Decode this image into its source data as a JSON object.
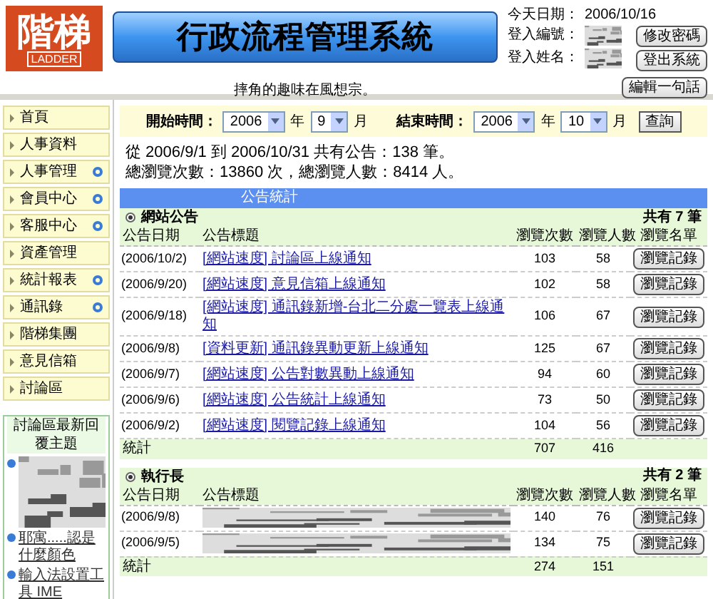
{
  "logo": {
    "text": "階梯",
    "subtext": "LADDER"
  },
  "banner": {
    "title": "行政流程管理系統"
  },
  "user_info": {
    "date_label": "今天日期：",
    "date": "2006/10/16",
    "id_label": "登入編號：",
    "name_label": "登入姓名："
  },
  "header_buttons": [
    "修改密碼",
    "登出系統"
  ],
  "motto": "摔角的趣味在風想宗。",
  "motto_button": "編輯一句話",
  "sidebar": {
    "items": [
      {
        "label": "首頁",
        "has_submenu": false
      },
      {
        "label": "人事資料",
        "has_submenu": false
      },
      {
        "label": "人事管理",
        "has_submenu": true
      },
      {
        "label": "會員中心",
        "has_submenu": true
      },
      {
        "label": "客服中心",
        "has_submenu": true
      },
      {
        "label": "資產管理",
        "has_submenu": false
      },
      {
        "label": "統計報表",
        "has_submenu": true
      },
      {
        "label": "通訊錄",
        "has_submenu": true
      },
      {
        "label": "階梯集團",
        "has_submenu": false
      },
      {
        "label": "意見信箱",
        "has_submenu": false
      },
      {
        "label": "討論區",
        "has_submenu": false
      }
    ],
    "forum_box": {
      "title": "討論區最新回覆主題",
      "items": [
        {
          "kind": "redacted"
        },
        {
          "kind": "link",
          "text": "耶寓.....認是什麼顏色"
        },
        {
          "kind": "link",
          "text": "輸入法設置工具 IME"
        }
      ]
    }
  },
  "filter": {
    "start_label": "開始時間：",
    "start_year": "2006",
    "start_year_unit": "年",
    "start_month": "9",
    "start_month_unit": "月",
    "end_label": "結束時間：",
    "end_year": "2006",
    "end_year_unit": "年",
    "end_month": "10",
    "end_month_unit": "月",
    "query_button": "查詢"
  },
  "summary": [
    "從 2006/9/1 到 2006/10/31 共有公告：138 筆。",
    "總瀏覽次數：13860 次，總瀏覽人數：8414 人。"
  ],
  "table_title": "公告統計",
  "sections": [
    {
      "name": "網站公告",
      "count": "共有 7 筆",
      "columns": [
        "公告日期",
        "公告標題",
        "瀏覽次數",
        "瀏覽人數",
        "瀏覽名單"
      ],
      "rows": [
        {
          "kind": "link",
          "date": "(2006/10/2)",
          "title": "[網站速度] 討論區上線通知",
          "views": "103",
          "people": "58",
          "button": "瀏覽記錄"
        },
        {
          "kind": "link",
          "date": "(2006/9/20)",
          "title": "[網站速度] 意見信箱上線通知",
          "views": "102",
          "people": "58",
          "button": "瀏覽記錄"
        },
        {
          "kind": "link",
          "date": "(2006/9/18)",
          "title": "[網站速度] 通訊錄新增-台北二分處一覽表上線通知",
          "views": "106",
          "people": "67",
          "button": "瀏覽記錄"
        },
        {
          "kind": "link",
          "date": "(2006/9/8)",
          "title": "[資料更新] 通訊錄異動更新上線通知",
          "views": "125",
          "people": "67",
          "button": "瀏覽記錄"
        },
        {
          "kind": "link",
          "date": "(2006/9/7)",
          "title": "[網站速度] 公告對數異動上線通知",
          "views": "94",
          "people": "60",
          "button": "瀏覽記錄"
        },
        {
          "kind": "link",
          "date": "(2006/9/6)",
          "title": "[網站速度] 公告統計上線通知",
          "views": "73",
          "people": "50",
          "button": "瀏覽記錄"
        },
        {
          "kind": "link",
          "date": "(2006/9/2)",
          "title": "[網站速度] 閱覽記錄上線通知",
          "views": "104",
          "people": "56",
          "button": "瀏覽記錄"
        }
      ],
      "total": {
        "label": "統計",
        "views": "707",
        "people": "416"
      }
    },
    {
      "name": "執行長",
      "count": "共有 2 筆",
      "columns": [
        "公告日期",
        "公告標題",
        "瀏覽次數",
        "瀏覽人數",
        "瀏覽名單"
      ],
      "rows": [
        {
          "kind": "redacted",
          "date": "(2006/9/8)",
          "views": "140",
          "people": "76",
          "button": "瀏覽記錄"
        },
        {
          "kind": "redacted",
          "date": "(2006/9/5)",
          "views": "134",
          "people": "75",
          "button": "瀏覽記錄"
        }
      ],
      "total": {
        "label": "統計",
        "views": "274",
        "people": "151"
      }
    }
  ]
}
